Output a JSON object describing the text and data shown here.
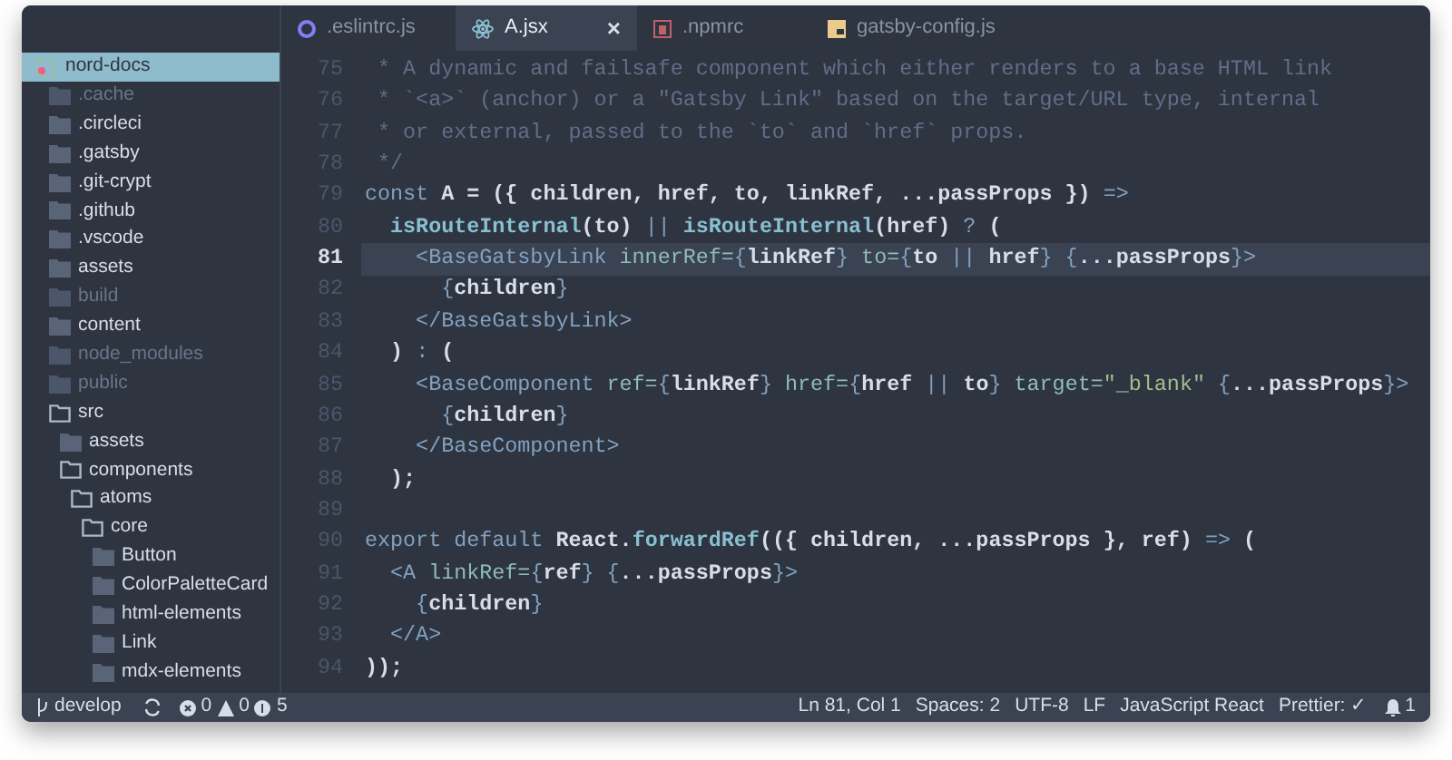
{
  "tabs": [
    {
      "label": ".eslintrc.js",
      "kind": "eslint",
      "selected": false
    },
    {
      "label": "A.jsx",
      "kind": "react",
      "selected": true,
      "close": "×"
    },
    {
      "label": ".npmrc",
      "kind": "npm",
      "selected": false
    },
    {
      "label": "gatsby-config.js",
      "kind": "js",
      "selected": false
    }
  ],
  "sidebar": {
    "items": [
      {
        "label": "nord-docs",
        "selected": true,
        "ignored": false,
        "kind": "root"
      },
      {
        "label": ".cache",
        "selected": false,
        "ignored": true,
        "kind": "folder"
      },
      {
        "label": ".circleci",
        "selected": false,
        "ignored": false,
        "kind": "folder"
      },
      {
        "label": ".gatsby",
        "selected": false,
        "ignored": false,
        "kind": "folder"
      },
      {
        "label": ".git-crypt",
        "selected": false,
        "ignored": false,
        "kind": "folder"
      },
      {
        "label": ".github",
        "selected": false,
        "ignored": false,
        "kind": "folder"
      },
      {
        "label": ".vscode",
        "selected": false,
        "ignored": false,
        "kind": "folder"
      },
      {
        "label": "assets",
        "selected": false,
        "ignored": false,
        "kind": "folder"
      },
      {
        "label": "build",
        "selected": false,
        "ignored": true,
        "kind": "folder"
      },
      {
        "label": "content",
        "selected": false,
        "ignored": false,
        "kind": "folder"
      },
      {
        "label": "node_modules",
        "selected": false,
        "ignored": true,
        "kind": "folder"
      },
      {
        "label": "public",
        "selected": false,
        "ignored": true,
        "kind": "folder"
      },
      {
        "label": "src",
        "selected": false,
        "ignored": false,
        "kind": "folder",
        "expanded": true,
        "children": [
          {
            "label": "assets",
            "selected": false,
            "ignored": false,
            "kind": "folder"
          },
          {
            "label": "components",
            "selected": false,
            "ignored": false,
            "kind": "folder",
            "expanded": true,
            "children": [
              {
                "label": "atoms",
                "selected": false,
                "ignored": false,
                "kind": "folder",
                "expanded": true,
                "children": [
                  {
                    "label": "core",
                    "selected": false,
                    "ignored": false,
                    "kind": "folder",
                    "expanded": true,
                    "children": [
                      {
                        "label": "Button",
                        "selected": false,
                        "ignored": false,
                        "kind": "folder"
                      },
                      {
                        "label": "ColorPaletteCard",
                        "selected": false,
                        "ignored": false,
                        "kind": "folder"
                      },
                      {
                        "label": "html-elements",
                        "selected": false,
                        "ignored": false,
                        "kind": "folder"
                      },
                      {
                        "label": "Link",
                        "selected": false,
                        "ignored": false,
                        "kind": "folder"
                      },
                      {
                        "label": "mdx-elements",
                        "selected": false,
                        "ignored": false,
                        "kind": "folder"
                      }
                    ]
                  }
                ]
              }
            ]
          }
        ]
      }
    ]
  },
  "editor": {
    "lines": [
      {
        "number": "75",
        "active": false,
        "tokens": [
          {
            "kind": "comment",
            "text": " * A dynamic and failsafe component which either renders to a base HTML link"
          }
        ]
      },
      {
        "number": "76",
        "active": false,
        "tokens": [
          {
            "kind": "comment",
            "text": " * `<a>` (anchor) or a \"Gatsby Link\" based on the target/URL type, internal"
          }
        ]
      },
      {
        "number": "77",
        "active": false,
        "tokens": [
          {
            "kind": "comment",
            "text": " * or external, passed to the `to` and `href` props."
          }
        ]
      },
      {
        "number": "78",
        "active": false,
        "tokens": [
          {
            "kind": "comment",
            "text": " */"
          }
        ]
      },
      {
        "number": "79",
        "active": false,
        "tokens": [
          {
            "kind": "keyword",
            "text": "const"
          },
          {
            "kind": "ident",
            "text": " A = ({ children, href, to, linkRef, ...passProps }) "
          },
          {
            "kind": "keyword",
            "text": "=>"
          }
        ]
      },
      {
        "number": "80",
        "active": false,
        "tokens": [
          {
            "kind": "func",
            "text": "  isRouteInternal"
          },
          {
            "kind": "ident",
            "text": "(to) "
          },
          {
            "kind": "keyword",
            "text": "||"
          },
          {
            "kind": "func",
            "text": " isRouteInternal"
          },
          {
            "kind": "ident",
            "text": "(href) "
          },
          {
            "kind": "keyword",
            "text": "?"
          },
          {
            "kind": "ident",
            "text": " ("
          }
        ]
      },
      {
        "number": "81",
        "active": true,
        "tokens": [
          {
            "kind": "tag",
            "text": "    <BaseGatsbyLink"
          },
          {
            "kind": "attr",
            "text": " innerRef="
          },
          {
            "kind": "punct",
            "text": "{"
          },
          {
            "kind": "ident",
            "text": "linkRef"
          },
          {
            "kind": "punct",
            "text": "}"
          },
          {
            "kind": "attr",
            "text": " to="
          },
          {
            "kind": "punct",
            "text": "{"
          },
          {
            "kind": "ident",
            "text": "to "
          },
          {
            "kind": "keyword",
            "text": "||"
          },
          {
            "kind": "ident",
            "text": " href"
          },
          {
            "kind": "punct",
            "text": "} {"
          },
          {
            "kind": "ident",
            "text": "...passProps"
          },
          {
            "kind": "punct",
            "text": "}>"
          }
        ]
      },
      {
        "number": "82",
        "active": false,
        "tokens": [
          {
            "kind": "punct",
            "text": "      {"
          },
          {
            "kind": "ident",
            "text": "children"
          },
          {
            "kind": "punct",
            "text": "}"
          }
        ]
      },
      {
        "number": "83",
        "active": false,
        "tokens": [
          {
            "kind": "tag",
            "text": "    </BaseGatsbyLink>"
          }
        ]
      },
      {
        "number": "84",
        "active": false,
        "tokens": [
          {
            "kind": "ident",
            "text": "  ) "
          },
          {
            "kind": "keyword",
            "text": ":"
          },
          {
            "kind": "ident",
            "text": " ("
          }
        ]
      },
      {
        "number": "85",
        "active": false,
        "tokens": [
          {
            "kind": "tag",
            "text": "    <BaseComponent"
          },
          {
            "kind": "attr",
            "text": " ref="
          },
          {
            "kind": "punct",
            "text": "{"
          },
          {
            "kind": "ident",
            "text": "linkRef"
          },
          {
            "kind": "punct",
            "text": "}"
          },
          {
            "kind": "attr",
            "text": " href="
          },
          {
            "kind": "punct",
            "text": "{"
          },
          {
            "kind": "ident",
            "text": "href "
          },
          {
            "kind": "keyword",
            "text": "||"
          },
          {
            "kind": "ident",
            "text": " to"
          },
          {
            "kind": "punct",
            "text": "}"
          },
          {
            "kind": "attr",
            "text": " target="
          },
          {
            "kind": "string",
            "text": "\"_blank\""
          },
          {
            "kind": "punct",
            "text": " {"
          },
          {
            "kind": "ident",
            "text": "...passProps"
          },
          {
            "kind": "punct",
            "text": "}>"
          }
        ]
      },
      {
        "number": "86",
        "active": false,
        "tokens": [
          {
            "kind": "punct",
            "text": "      {"
          },
          {
            "kind": "ident",
            "text": "children"
          },
          {
            "kind": "punct",
            "text": "}"
          }
        ]
      },
      {
        "number": "87",
        "active": false,
        "tokens": [
          {
            "kind": "tag",
            "text": "    </BaseComponent>"
          }
        ]
      },
      {
        "number": "88",
        "active": false,
        "tokens": [
          {
            "kind": "ident",
            "text": "  );"
          }
        ]
      },
      {
        "number": "89",
        "active": false
      },
      {
        "number": "90",
        "active": false,
        "tokens": [
          {
            "kind": "keyword",
            "text": "export default"
          },
          {
            "kind": "ident",
            "text": " React."
          },
          {
            "kind": "func",
            "text": "forwardRef"
          },
          {
            "kind": "ident",
            "text": "(({ children, ...passProps }, ref) "
          },
          {
            "kind": "keyword",
            "text": "=>"
          },
          {
            "kind": "ident",
            "text": " ("
          }
        ]
      },
      {
        "number": "91",
        "active": false,
        "tokens": [
          {
            "kind": "tag",
            "text": "  <A"
          },
          {
            "kind": "attr",
            "text": " linkRef="
          },
          {
            "kind": "punct",
            "text": "{"
          },
          {
            "kind": "ident",
            "text": "ref"
          },
          {
            "kind": "punct",
            "text": "} {"
          },
          {
            "kind": "ident",
            "text": "...passProps"
          },
          {
            "kind": "punct",
            "text": "}>"
          }
        ]
      },
      {
        "number": "92",
        "active": false,
        "tokens": [
          {
            "kind": "punct",
            "text": "    {"
          },
          {
            "kind": "ident",
            "text": "children"
          },
          {
            "kind": "punct",
            "text": "}"
          }
        ]
      },
      {
        "number": "93",
        "active": false,
        "tokens": [
          {
            "kind": "tag",
            "text": "  </A>"
          }
        ]
      },
      {
        "number": "94",
        "active": false,
        "tokens": [
          {
            "kind": "ident",
            "text": "));"
          }
        ]
      }
    ]
  },
  "status_bar": {
    "branch": "develop",
    "errors": "0",
    "warnings": "0",
    "infos": "5",
    "right": [
      {
        "text": "Ln 81, Col 1",
        "kind": "text"
      },
      {
        "text": "Spaces: 2",
        "kind": "text"
      },
      {
        "text": "UTF-8",
        "kind": "text"
      },
      {
        "text": "LF",
        "kind": "text"
      },
      {
        "text": "JavaScript React",
        "kind": "text"
      },
      {
        "text": "Prettier: ✓",
        "kind": "text"
      },
      {
        "text": "1",
        "kind": "bell"
      }
    ]
  }
}
